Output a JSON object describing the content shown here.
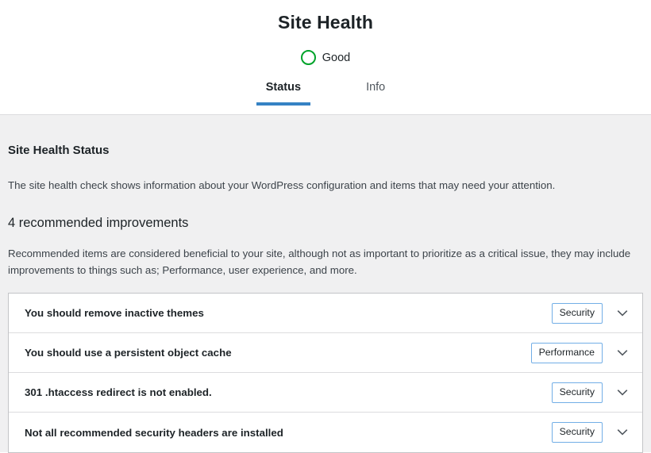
{
  "header": {
    "title": "Site Health",
    "status": {
      "icon": "status-ring-icon",
      "label": "Good",
      "color": "#00a32a"
    },
    "tabs": [
      {
        "label": "Status",
        "active": true
      },
      {
        "label": "Info",
        "active": false
      }
    ]
  },
  "main": {
    "section_title": "Site Health Status",
    "section_description": "The site health check shows information about your WordPress configuration and items that may need your attention.",
    "improvements_title": "4 recommended improvements",
    "improvements_description": "Recommended items are considered beneficial to your site, although not as important to prioritize as a critical issue, they may include improvements to things such as; Performance, user experience, and more.",
    "issues": [
      {
        "title": "You should remove inactive themes",
        "badge": "Security",
        "toggle_icon": "chevron-down-icon"
      },
      {
        "title": "You should use a persistent object cache",
        "badge": "Performance",
        "toggle_icon": "chevron-down-icon"
      },
      {
        "title": "301 .htaccess redirect is not enabled.",
        "badge": "Security",
        "toggle_icon": "chevron-down-icon"
      },
      {
        "title": "Not all recommended security headers are installed",
        "badge": "Security",
        "toggle_icon": "chevron-down-icon"
      }
    ]
  },
  "theme": {
    "accent": "#3582c4",
    "badge_border": "#72aee6",
    "background": "#f0f0f1",
    "text": "#1d2327"
  }
}
